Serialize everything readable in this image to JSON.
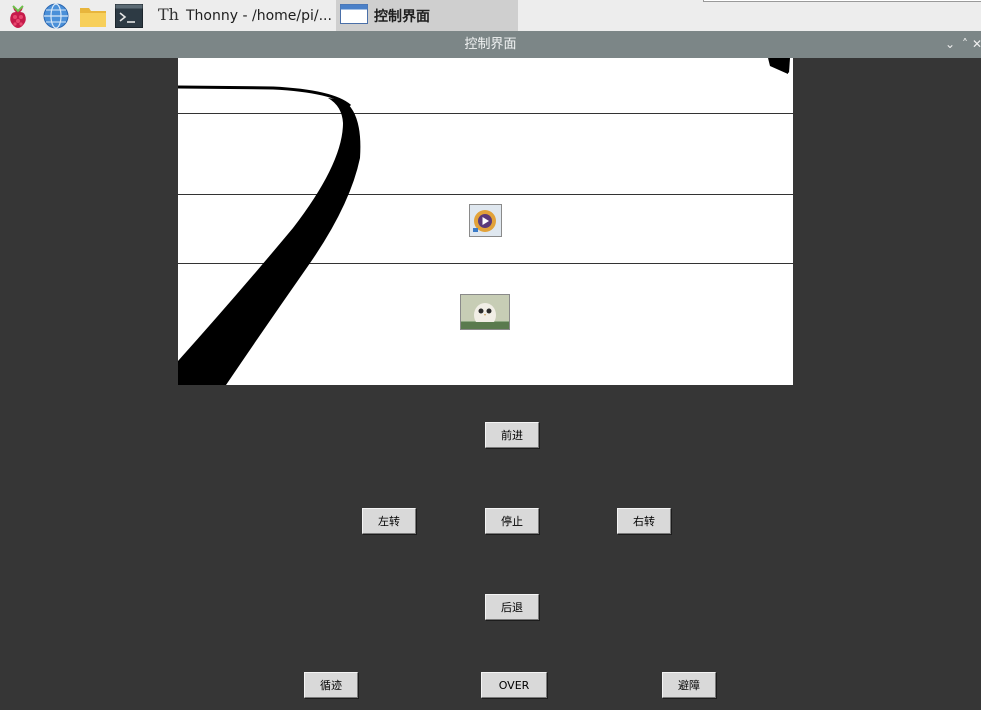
{
  "taskbar": {
    "launchers": [
      "raspberry-menu-icon",
      "globe-icon",
      "folder-icon",
      "terminal-icon"
    ],
    "tasks": [
      {
        "label": "Thonny  -  /home/pi/...",
        "icon": "thonny-icon"
      },
      {
        "label": "控制界面",
        "icon": "window-icon",
        "active": true
      }
    ]
  },
  "window": {
    "title": "控制界面",
    "controls": [
      "chevron-down-icon",
      "chevron-up-icon",
      "close-icon"
    ],
    "control_glyphs": {
      "minimize": "⌄",
      "maximize": "˄",
      "close": "✕"
    }
  },
  "canvas": {
    "background": "#ffffff",
    "thumbnails": [
      "video-play-thumbnail",
      "owl-photo-thumbnail"
    ]
  },
  "controls": {
    "forward": "前进",
    "left": "左转",
    "stop": "停止",
    "right": "右转",
    "backward": "后退",
    "line_follow": "循迹",
    "over": "OVER",
    "avoid": "避障"
  },
  "colors": {
    "window_bg": "#363636",
    "titlebar_bg": "#7c8687",
    "button_bg": "#d9d9d9",
    "taskbar_bg": "#ededed"
  }
}
